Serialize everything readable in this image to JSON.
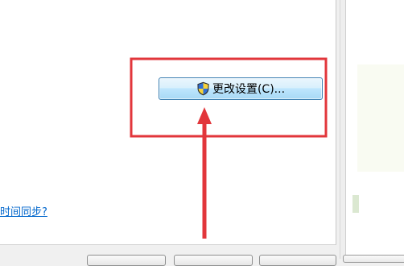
{
  "dialog": {
    "change_settings_button": {
      "label": "更改设置(C)...",
      "icon": "uac-shield-icon"
    },
    "sync_link": {
      "text": "时间同步?"
    }
  },
  "annotation": {
    "highlight_color": "#e2363b",
    "arrow_color": "#e2363b"
  },
  "colors": {
    "button_border": "#3c7fb1",
    "button_fill_top": "#eaf6fd",
    "button_fill_bottom": "#a7d9f5",
    "link": "#0066cc"
  }
}
